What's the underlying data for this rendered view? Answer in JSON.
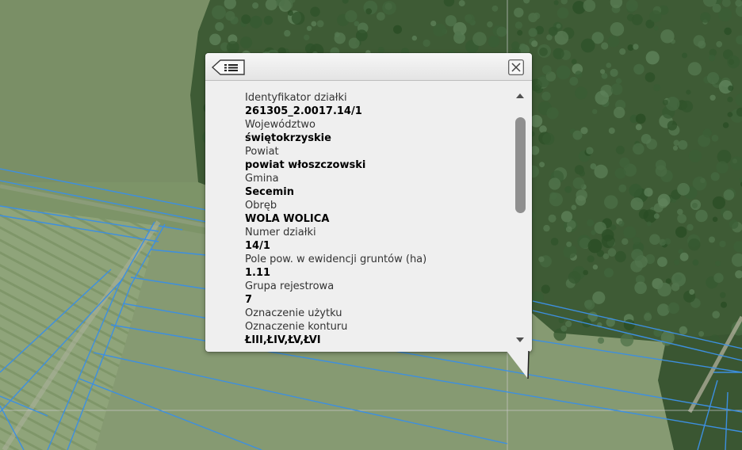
{
  "map": {
    "name": "orthophoto-with-parcel-boundaries",
    "parcel_line_color": "#3d8fe0",
    "forest_color": "#3b5a32",
    "field_color": "#8a9e74"
  },
  "popup": {
    "list_icon": "list-icon",
    "close_icon": "close-icon",
    "fields": [
      {
        "label": "Identyfikator działki",
        "value": "261305_2.0017.14/1"
      },
      {
        "label": "Województwo",
        "value": "świętokrzyskie"
      },
      {
        "label": "Powiat",
        "value": "powiat włoszczowski"
      },
      {
        "label": "Gmina",
        "value": "Secemin"
      },
      {
        "label": "Obręb",
        "value": "WOLA WOLICA"
      },
      {
        "label": "Numer działki",
        "value": "14/1"
      },
      {
        "label": "Pole pow. w ewidencji gruntów (ha)",
        "value": "1.11"
      },
      {
        "label": "Grupa rejestrowa",
        "value": "7"
      },
      {
        "label": "Oznaczenie użytku",
        "value": ""
      },
      {
        "label": "Oznaczenie konturu",
        "value": "ŁIII,ŁIV,ŁV,ŁVI"
      }
    ],
    "scrollbar": {
      "position_fraction": 0.0,
      "visible_fraction": 0.4
    }
  }
}
